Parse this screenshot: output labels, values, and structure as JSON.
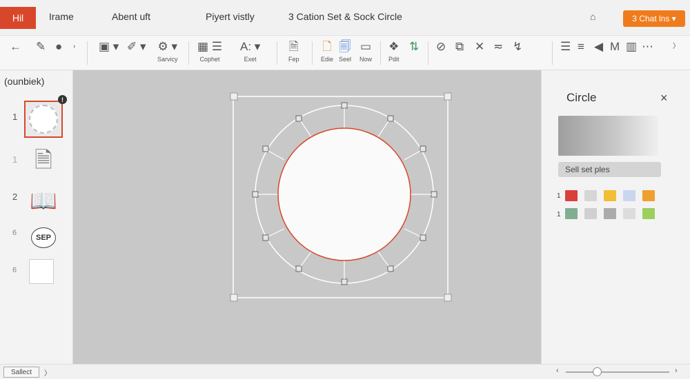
{
  "tabs": {
    "file": "Hil",
    "t1": "Irame",
    "t2": "Abent uft",
    "t3": "Piyert vistly",
    "t4": "3 Cation Set & Sock Circle",
    "cta": "3 Chat lns ▾"
  },
  "ribbon": {
    "service": "Sarvicy",
    "cophet": "Cophet",
    "exet": "Exet",
    "fep": "Fep",
    "edie": "Edie",
    "seel": "Seel",
    "now": "Now",
    "pdit": "Pdit",
    "text_a": "A",
    "text_m": "M"
  },
  "left": {
    "title": "(ounbiek)",
    "thumbs": [
      {
        "num": "1"
      },
      {
        "num": "1"
      },
      {
        "num": "2"
      },
      {
        "num": "6",
        "label": "SEP"
      },
      {
        "num": "6"
      }
    ],
    "badge": "!"
  },
  "panel": {
    "title": "Circle",
    "close": "×",
    "preset": "Sell set ples",
    "row1_label": "1",
    "row2_label": "1",
    "row1_colors": [
      "#d8413a",
      "#d6d6d6",
      "#f2be33",
      "#c9d6ee",
      "#eea02e"
    ],
    "row2_colors": [
      "#7fae92",
      "#d0d0d0",
      "#ababab",
      "#dcdcdc",
      "#9ccf5e"
    ]
  },
  "status": {
    "select": "Sallect",
    "chevron": "〉",
    "zoom_minus": "‹",
    "zoom_plus": "›",
    "zoom_level": 0.3
  },
  "colors": {
    "accent": "#d9472b",
    "cta": "#f07b1c",
    "canvas": "#c8c8c8"
  }
}
